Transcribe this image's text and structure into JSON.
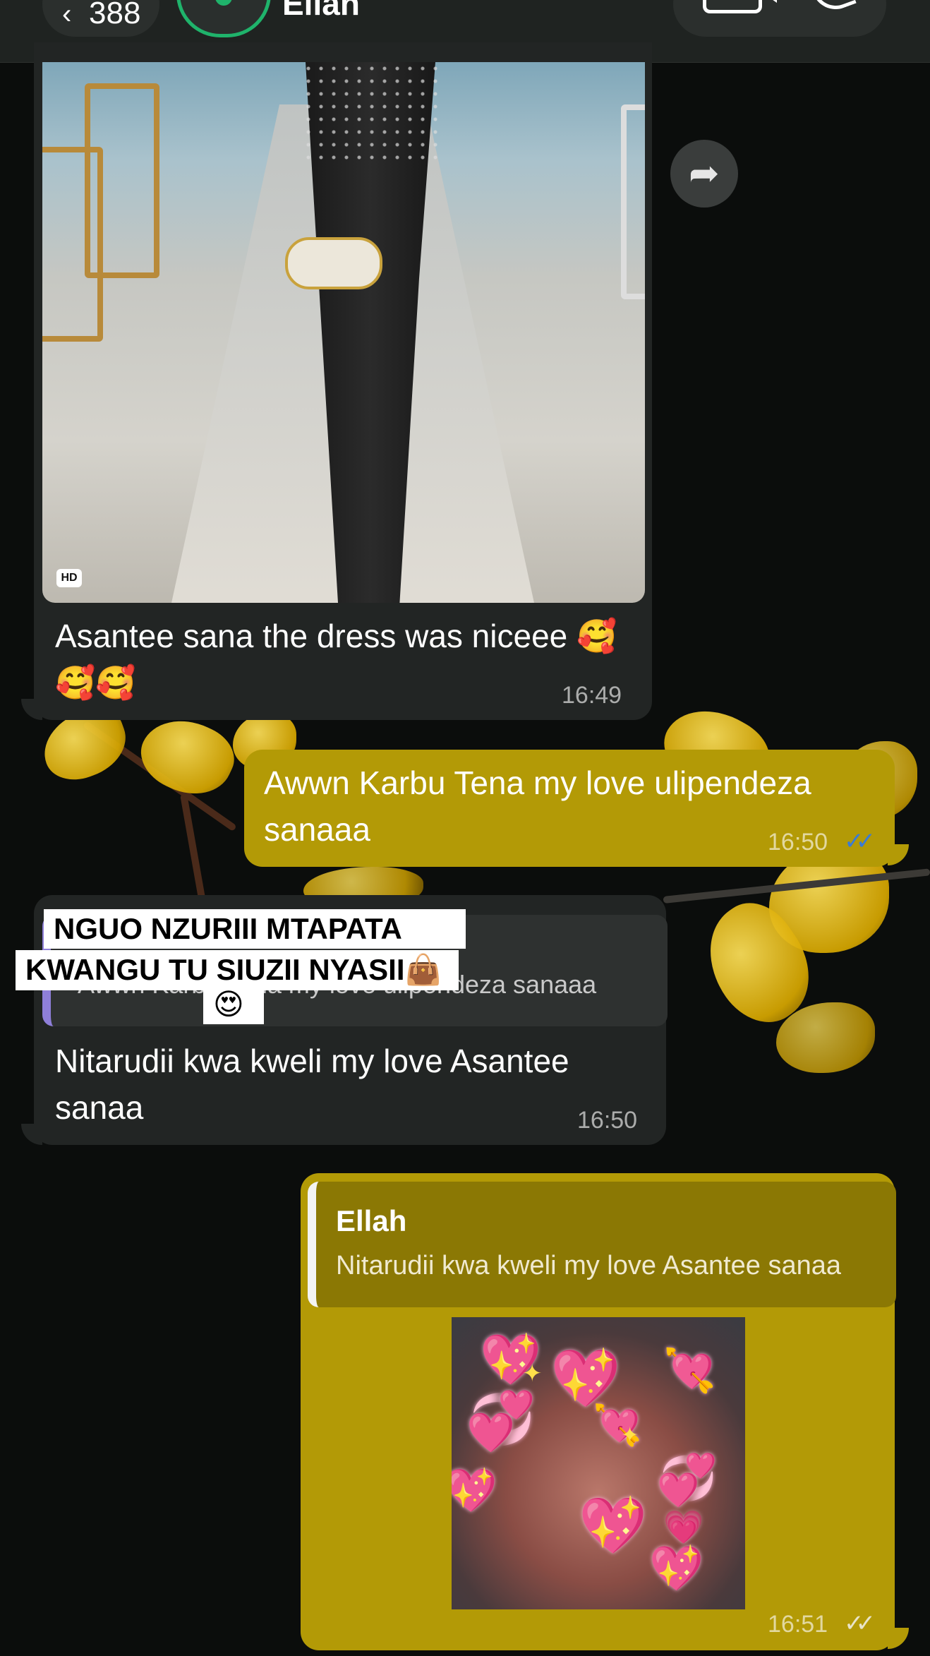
{
  "header": {
    "back_count": "388",
    "contact_name": "Ellah"
  },
  "messages": [
    {
      "id": "m1",
      "text": "Asantee sana the dress was niceee 🥰🥰🥰",
      "time": "16:49",
      "hd_badge": "HD"
    },
    {
      "id": "m2",
      "text": "Awwn Karbu Tena my love ulipendeza sanaaa",
      "time": "16:50",
      "ticks": "✓✓"
    },
    {
      "id": "m3",
      "quoted_text": "Awwn Karbu Tena my love ulipendeza sanaaa",
      "overlay_line1": "NGUO NZURIII MTAPATA",
      "overlay_line2": "KWANGU TU SIUZII NYASII👜",
      "overlay_emoji": "😍",
      "text": "Nitarudii kwa kweli my love Asantee sanaa",
      "time": "16:50"
    },
    {
      "id": "m4",
      "quoted_name": "Ellah",
      "quoted_text": "Nitarudii kwa kweli my love Asantee sanaa",
      "time": "16:51",
      "ticks": "✓✓"
    }
  ],
  "colors": {
    "incoming_bubble": "#222524",
    "outgoing_bubble": "#b39a06",
    "read_ticks": "#3a7bd5",
    "delivered_ticks": "#e8e4c8"
  }
}
